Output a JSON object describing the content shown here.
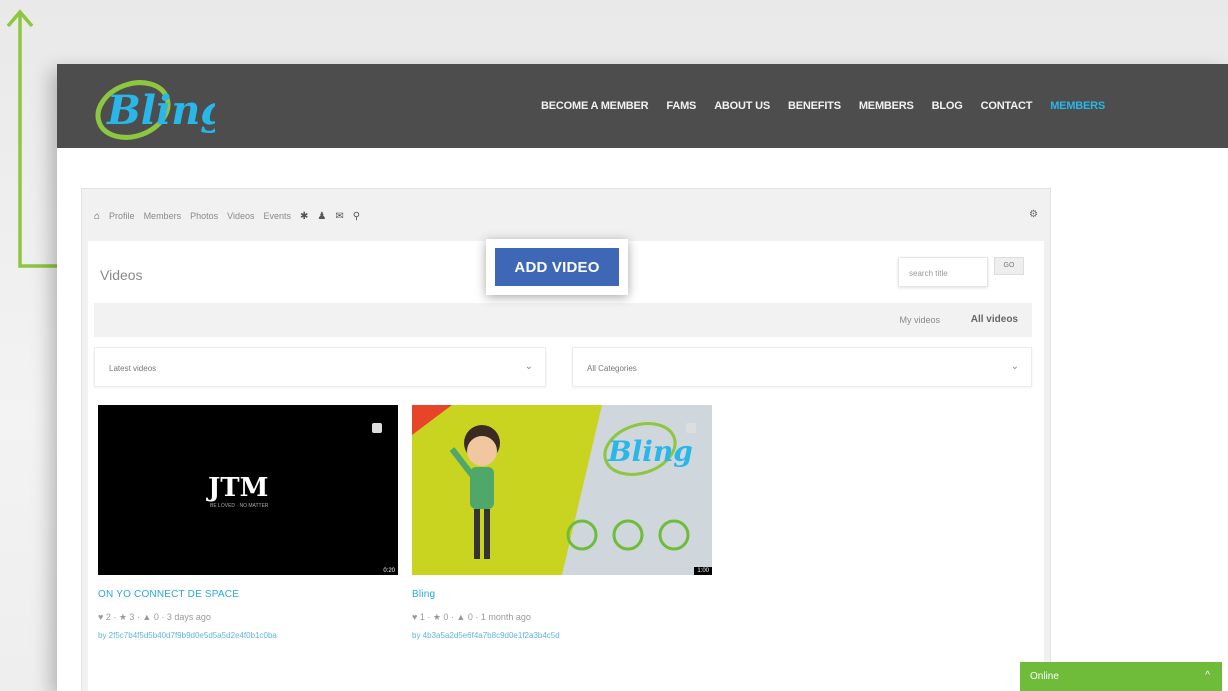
{
  "header": {
    "logo_text": "Bling",
    "nav": [
      "BECOME A MEMBER",
      "FAMS",
      "ABOUT US",
      "BENEFITS",
      "MEMBERS",
      "BLOG",
      "CONTACT",
      "MEMBERS"
    ]
  },
  "subnav": {
    "links": [
      "Profile",
      "Members",
      "Photos",
      "Videos",
      "Events"
    ]
  },
  "videos": {
    "title": "Videos",
    "add_button": "ADD VIDEO",
    "search_placeholder": "search title",
    "search_button": "GO",
    "my_videos": "My videos",
    "all_videos": "All videos",
    "sort_select": "Latest videos",
    "category_select": "All Categories"
  },
  "cards": [
    {
      "thumb_text": "JTM",
      "thumb_sub": "BE LOVED · NO MATTER",
      "duration": "0:20",
      "title": "ON YO CONNECT DE SPACE",
      "meta": "♥ 2 · ★ 3 · ▲ 0 · 3 days ago",
      "author": "by 2f5c7b4f5d5b40d7f9b9d0e5d5a5d2e4f0b1c0ba"
    },
    {
      "thumb_text": "Bling",
      "duration": "1:00",
      "title": "Bling",
      "meta": "♥ 1 · ★ 0 · ▲ 0 · 1 month ago",
      "author": "by 4b3a5a2d5e6f4a7b8c9d0e1f2a3b4c5d"
    }
  ],
  "chat": {
    "label": "Online",
    "toggle": "^"
  },
  "colors": {
    "topbar": "#4d4d4d",
    "accent_blue": "#29b6e8",
    "button_blue": "#3e67b6",
    "guide_green": "#8dc63f",
    "chat_green": "#6fbb3a"
  }
}
